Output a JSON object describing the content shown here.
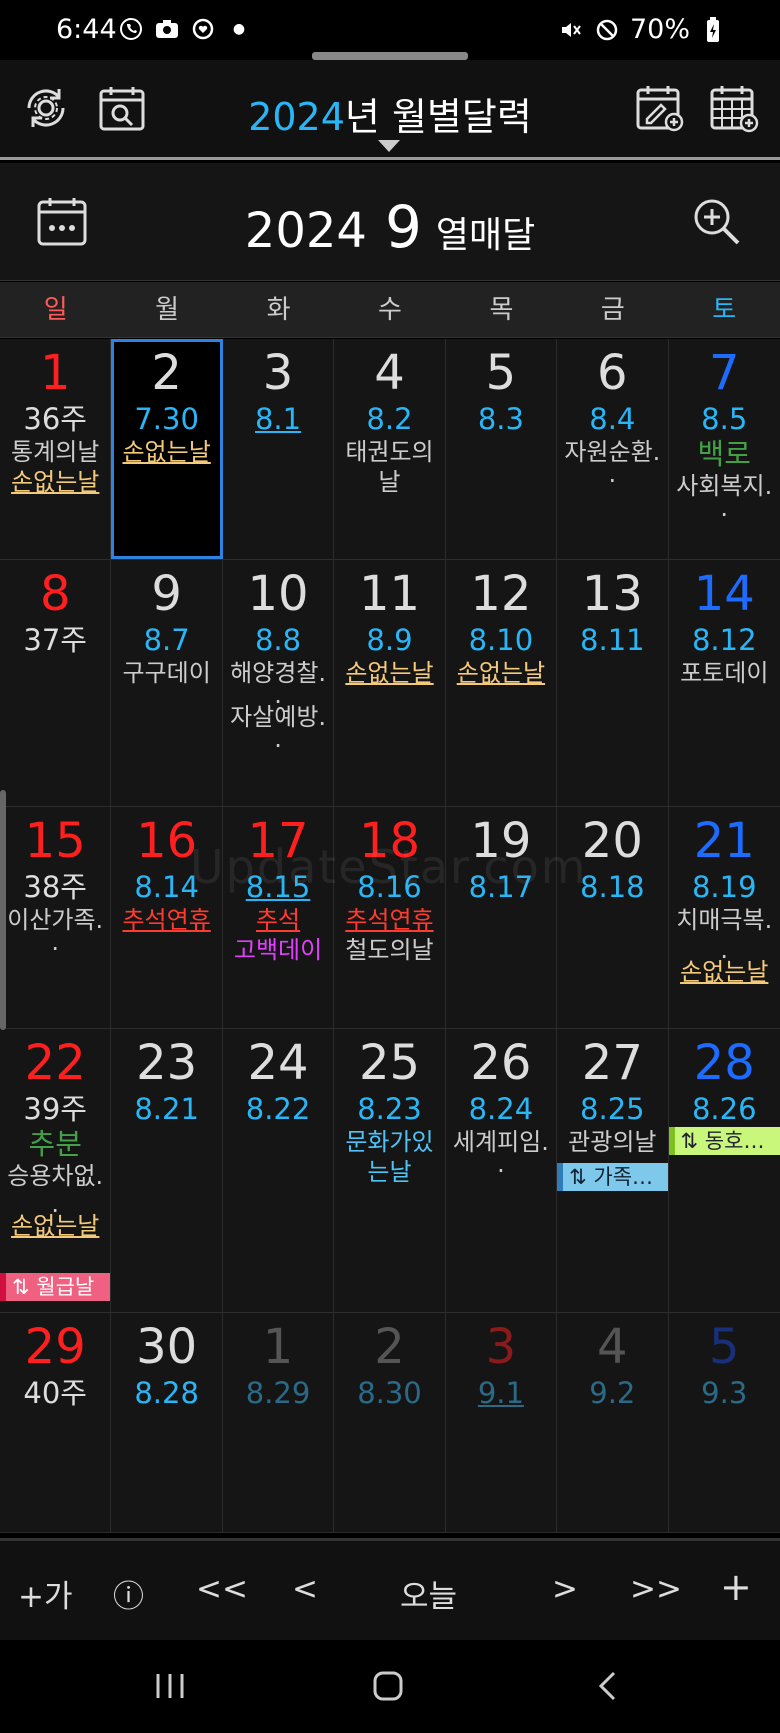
{
  "status": {
    "time": "6:44",
    "battery": "70%"
  },
  "appbar": {
    "year": "2024",
    "title_suffix": "년 월별달력"
  },
  "month": {
    "year": "2024",
    "month": "9",
    "name": "열매달"
  },
  "weekdays": [
    "일",
    "월",
    "화",
    "수",
    "목",
    "금",
    "토"
  ],
  "weeks": [
    {
      "cells": [
        {
          "day": "1",
          "sub": "36주",
          "ev1": "통계의날",
          "ev2": "손없는날"
        },
        {
          "day": "2",
          "sub": "7.30",
          "ev1": "손없는날"
        },
        {
          "day": "3",
          "sub": "8.1"
        },
        {
          "day": "4",
          "sub": "8.2",
          "ev1": "태권도의",
          "ev2": "날"
        },
        {
          "day": "5",
          "sub": "8.3"
        },
        {
          "day": "6",
          "sub": "8.4",
          "ev1": "자원순환.",
          "ev2": "."
        },
        {
          "day": "7",
          "sub": "8.5",
          "ev1": "백로",
          "ev2": "사회복지.",
          "ev3": "."
        }
      ]
    },
    {
      "cells": [
        {
          "day": "8",
          "sub": "37주"
        },
        {
          "day": "9",
          "sub": "8.7",
          "ev1": "구구데이"
        },
        {
          "day": "10",
          "sub": "8.8",
          "ev1": "해양경찰.",
          "ev2": ".",
          "ev3": "자살예방.",
          "ev4": "."
        },
        {
          "day": "11",
          "sub": "8.9",
          "ev1": "손없는날"
        },
        {
          "day": "12",
          "sub": "8.10",
          "ev1": "손없는날"
        },
        {
          "day": "13",
          "sub": "8.11"
        },
        {
          "day": "14",
          "sub": "8.12",
          "ev1": "포토데이"
        }
      ]
    },
    {
      "cells": [
        {
          "day": "15",
          "sub": "38주",
          "ev1": "이산가족.",
          "ev2": "."
        },
        {
          "day": "16",
          "sub": "8.14",
          "ev1": "추석연휴"
        },
        {
          "day": "17",
          "sub": "8.15",
          "ev1": "추석",
          "ev2": "고백데이"
        },
        {
          "day": "18",
          "sub": "8.16",
          "ev1": "추석연휴",
          "ev2": "철도의날"
        },
        {
          "day": "19",
          "sub": "8.17"
        },
        {
          "day": "20",
          "sub": "8.18"
        },
        {
          "day": "21",
          "sub": "8.19",
          "ev1": "치매극복.",
          "ev2": ".",
          "ev3": "손없는날"
        }
      ]
    },
    {
      "cells": [
        {
          "day": "22",
          "sub": "39주",
          "ev1": "추분",
          "ev2": "승용차없.",
          "ev3": ".",
          "ev4": "손없는날",
          "tag": "⇅ 월급날"
        },
        {
          "day": "23",
          "sub": "8.21"
        },
        {
          "day": "24",
          "sub": "8.22"
        },
        {
          "day": "25",
          "sub": "8.23",
          "ev1": "문화가있",
          "ev2": "는날"
        },
        {
          "day": "26",
          "sub": "8.24",
          "ev1": "세계피임.",
          "ev2": "."
        },
        {
          "day": "27",
          "sub": "8.25",
          "ev1": "관광의날",
          "tag": "⇅ 가족…"
        },
        {
          "day": "28",
          "sub": "8.26",
          "tag": "⇅ 동호…"
        }
      ]
    },
    {
      "cells": [
        {
          "day": "29",
          "sub": "40주"
        },
        {
          "day": "30",
          "sub": "8.28"
        },
        {
          "day": "1",
          "sub": "8.29"
        },
        {
          "day": "2",
          "sub": "8.30"
        },
        {
          "day": "3",
          "sub": "9.1"
        },
        {
          "day": "4",
          "sub": "9.2"
        },
        {
          "day": "5",
          "sub": "9.3"
        }
      ]
    }
  ],
  "watermark": "UpdateStar.com",
  "bottom": {
    "add_text": "+가",
    "info": "ⓘ",
    "prev_year": "<<",
    "prev": "<",
    "today": "오늘",
    "next": ">",
    "next_year": ">>",
    "add": "+"
  },
  "colors": {
    "accent": "#29b6f6",
    "sunday": "#ff1f1f",
    "saturday": "#1e6cff",
    "today_border": "#2f82e0"
  }
}
